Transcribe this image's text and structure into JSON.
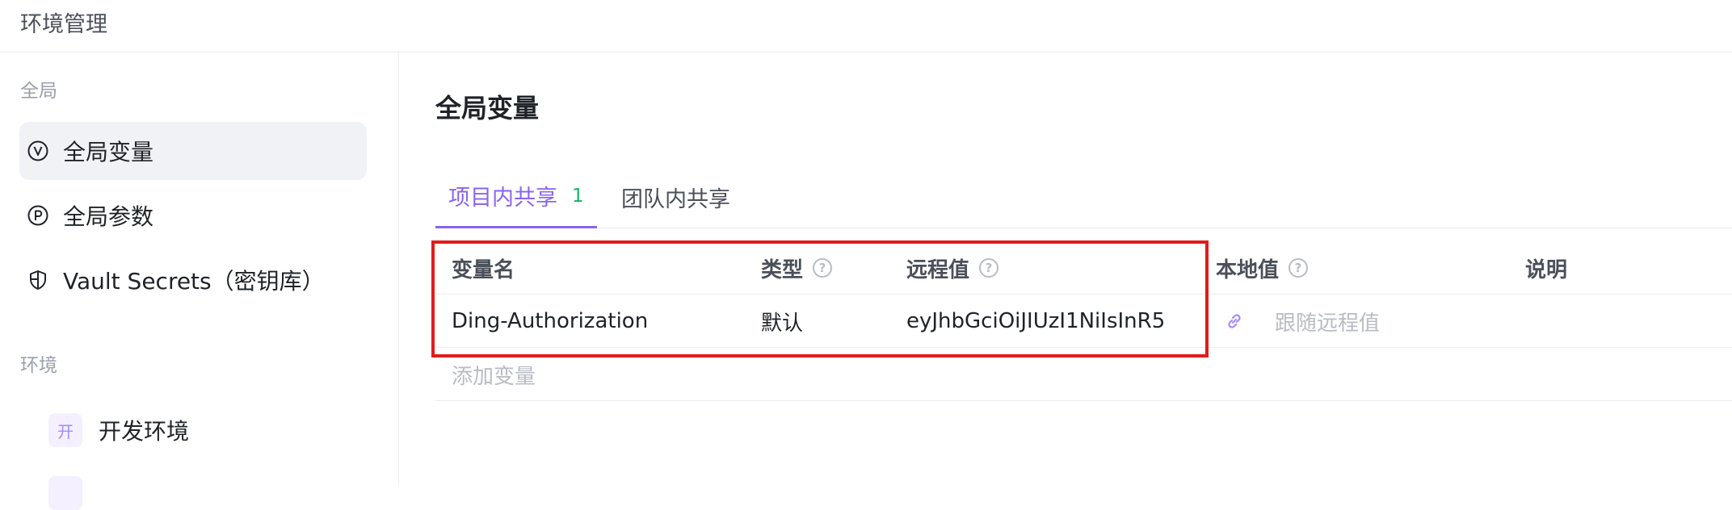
{
  "window": {
    "title": "环境管理"
  },
  "sidebar": {
    "section_global": "全局",
    "items": [
      {
        "label": "全局变量",
        "icon": "v-circle-icon",
        "active": true
      },
      {
        "label": "全局参数",
        "icon": "p-circle-icon",
        "active": false
      },
      {
        "label": "Vault Secrets（密钥库）",
        "icon": "shield-icon",
        "active": false
      }
    ],
    "section_env": "环境",
    "environments": [
      {
        "badge": "开",
        "label": "开发环境"
      }
    ]
  },
  "main": {
    "title": "全局变量",
    "tabs": [
      {
        "label": "项目内共享",
        "count": "1",
        "active": true
      },
      {
        "label": "团队内共享",
        "active": false
      }
    ],
    "table": {
      "columns": [
        "变量名",
        "类型",
        "远程值",
        "本地值",
        "说明"
      ],
      "rows": [
        {
          "name": "Ding-Authorization",
          "type": "默认",
          "remote": "eyJhbGciOiJIUzI1NiIsInR5",
          "local_placeholder": "跟随远程值",
          "desc": ""
        }
      ],
      "add_placeholder": "添加变量"
    }
  },
  "colors": {
    "accent": "#8a63f0",
    "count": "#17b26a",
    "highlight": "#e31b1b"
  }
}
